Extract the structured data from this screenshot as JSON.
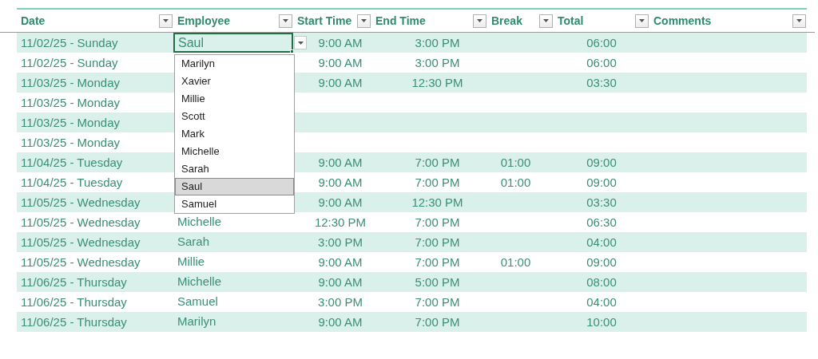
{
  "columns": [
    {
      "label": "Date"
    },
    {
      "label": "Employee"
    },
    {
      "label": "Start Time"
    },
    {
      "label": "End Time"
    },
    {
      "label": "Break"
    },
    {
      "label": "Total"
    },
    {
      "label": "Comments"
    }
  ],
  "rows": [
    {
      "date": "11/02/25 - Sunday",
      "employee": "Saul",
      "active": true,
      "start": "9:00 AM",
      "end": "3:00 PM",
      "total": "06:00"
    },
    {
      "date": "11/02/25 - Sunday",
      "active": false,
      "start": "9:00 AM",
      "end": "3:00 PM",
      "total": "06:00"
    },
    {
      "date": "11/03/25 - Monday",
      "active": false,
      "start": "9:00 AM",
      "end": "12:30 PM",
      "total": "03:30"
    },
    {
      "date": "11/03/25 - Monday",
      "active": false
    },
    {
      "date": "11/03/25 - Monday",
      "active": false
    },
    {
      "date": "11/03/25 - Monday",
      "active": false
    },
    {
      "date": "11/04/25 - Tuesday",
      "active": false,
      "start": "9:00 AM",
      "end": "7:00 PM",
      "break": "01:00",
      "total": "09:00"
    },
    {
      "date": "11/04/25 - Tuesday",
      "active": false,
      "start": "9:00 AM",
      "end": "7:00 PM",
      "break": "01:00",
      "total": "09:00"
    },
    {
      "date": "11/05/25 - Wednesday",
      "active": false,
      "start": "9:00 AM",
      "end": "12:30 PM",
      "total": "03:30"
    },
    {
      "date": "11/05/25 - Wednesday",
      "employee": "Michelle",
      "active": false,
      "start": "12:30 PM",
      "end": "7:00 PM",
      "total": "06:30"
    },
    {
      "date": "11/05/25 - Wednesday",
      "employee": "Sarah",
      "active": false,
      "start": "3:00 PM",
      "end": "7:00 PM",
      "total": "04:00"
    },
    {
      "date": "11/05/25 - Wednesday",
      "employee": "Millie",
      "active": false,
      "start": "9:00 AM",
      "end": "7:00 PM",
      "break": "01:00",
      "total": "09:00"
    },
    {
      "date": "11/06/25 - Thursday",
      "employee": "Michelle",
      "active": false,
      "start": "9:00 AM",
      "end": "5:00 PM",
      "total": "08:00"
    },
    {
      "date": "11/06/25 - Thursday",
      "employee": "Samuel",
      "active": false,
      "start": "3:00 PM",
      "end": "7:00 PM",
      "total": "04:00"
    },
    {
      "date": "11/06/25 - Thursday",
      "employee": "Marilyn",
      "active": false,
      "start": "9:00 AM",
      "end": "7:00 PM",
      "total": "10:00"
    }
  ],
  "dropdown": {
    "items": [
      {
        "label": "Marilyn",
        "selected": false
      },
      {
        "label": "Xavier",
        "selected": false
      },
      {
        "label": "Millie",
        "selected": false
      },
      {
        "label": "Scott",
        "selected": false
      },
      {
        "label": "Mark",
        "selected": false
      },
      {
        "label": "Michelle",
        "selected": false
      },
      {
        "label": "Sarah",
        "selected": false
      },
      {
        "label": "Saul",
        "selected": true
      },
      {
        "label": "Samuel",
        "selected": false
      }
    ]
  }
}
